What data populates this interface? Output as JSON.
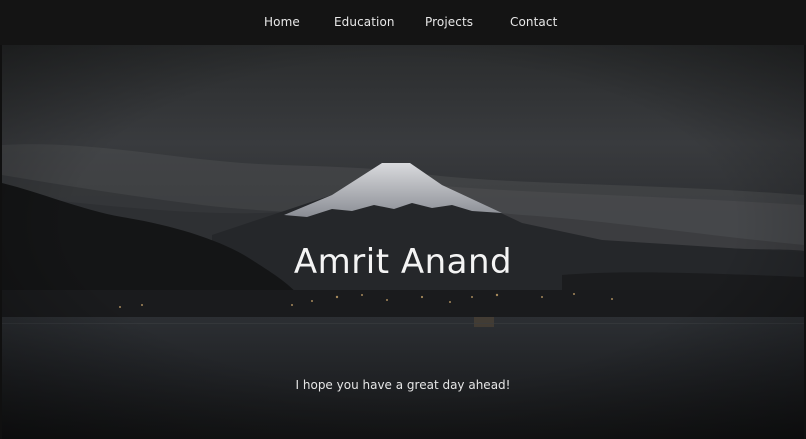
{
  "nav": {
    "items": [
      {
        "label": "Home"
      },
      {
        "label": "Education"
      },
      {
        "label": "Projects"
      },
      {
        "label": "Contact"
      }
    ]
  },
  "hero": {
    "title": "Amrit Anand",
    "subtitle": "I hope you have a great day ahead!",
    "background": "mountain-at-dusk-image"
  },
  "colors": {
    "nav_background": "#141414",
    "text": "#f4f4f4",
    "sky": "#3a3d40",
    "water": "#1e2022"
  }
}
